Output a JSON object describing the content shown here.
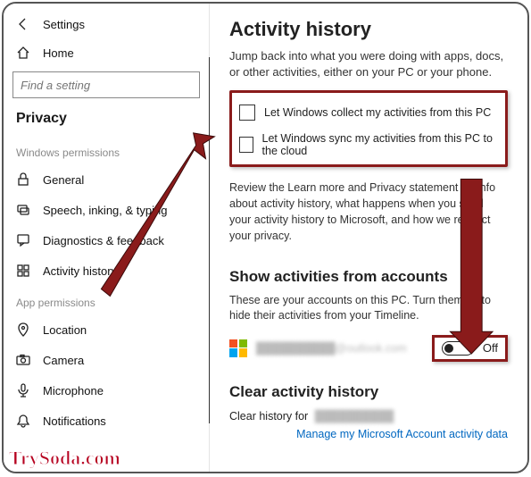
{
  "window": {
    "title": "Settings"
  },
  "sidebar": {
    "home": "Home",
    "search_placeholder": "Find a setting",
    "section": "Privacy",
    "group_windows": "Windows permissions",
    "group_app": "App permissions",
    "items_windows": [
      {
        "icon": "lock-icon",
        "label": "General"
      },
      {
        "icon": "speech-icon",
        "label": "Speech, inking, & typing"
      },
      {
        "icon": "feedback-icon",
        "label": "Diagnostics & feedback"
      },
      {
        "icon": "history-icon",
        "label": "Activity history"
      }
    ],
    "items_app": [
      {
        "icon": "location-icon",
        "label": "Location"
      },
      {
        "icon": "camera-icon",
        "label": "Camera"
      },
      {
        "icon": "mic-icon",
        "label": "Microphone"
      },
      {
        "icon": "notif-icon",
        "label": "Notifications"
      }
    ]
  },
  "main": {
    "h1": "Activity history",
    "intro": "Jump back into what you were doing with apps, docs, or other activities, either on your PC or your phone.",
    "check1": "Let Windows collect my activities from this PC",
    "check2": "Let Windows sync my activities from this PC to the cloud",
    "review": "Review the Learn more and Privacy statement for info about activity history, what happens when you send your activity history to Microsoft, and how we respect your privacy.",
    "h2": "Show activities from accounts",
    "accounts_sub": "These are your accounts on this PC. Turn them off to hide their activities from your Timeline.",
    "account_email": "██████████@outlook.com",
    "toggle_label": "Off",
    "h3": "Clear activity history",
    "clear_line_prefix": "Clear history for",
    "clear_line_account": "██████████",
    "manage_link": "Manage my Microsoft Account activity data"
  },
  "watermark": "TrySoda.com"
}
